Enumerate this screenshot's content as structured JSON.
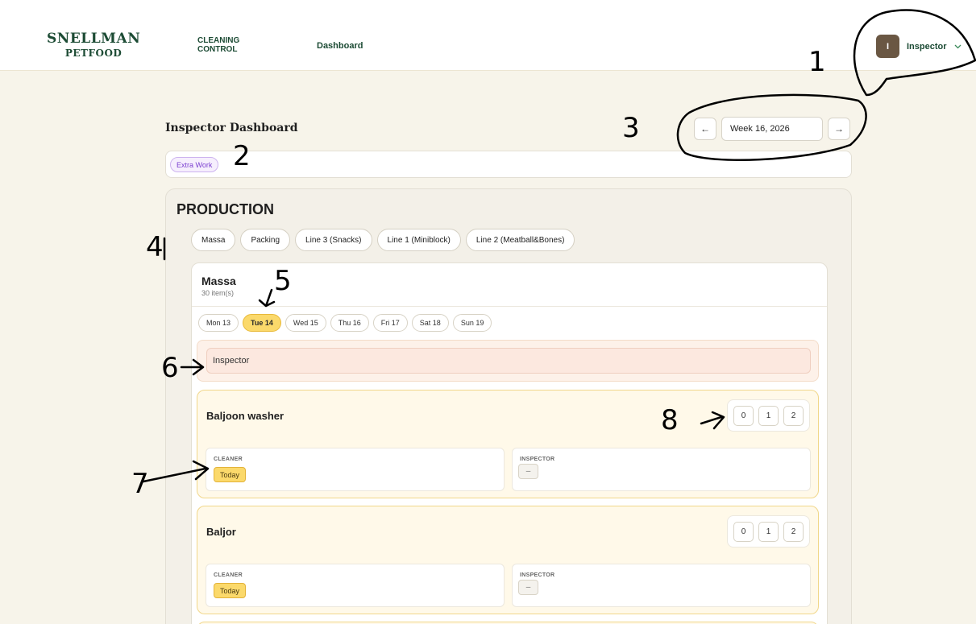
{
  "header": {
    "logo_line1": "SNELLMAN",
    "logo_line2": "PETFOOD",
    "app_line1": "CLEANING",
    "app_line2": "CONTROL",
    "nav_dashboard": "Dashboard",
    "user_initial": "I",
    "user_name": "Inspector"
  },
  "page": {
    "title": "Inspector Dashboard",
    "week_label": "Week 16, 2026",
    "prev_arrow": "←",
    "next_arrow": "→"
  },
  "filters": {
    "extra_work": "Extra Work"
  },
  "production": {
    "title": "PRODUCTION",
    "lines": [
      "Massa",
      "Packing",
      "Line 3 (Snacks)",
      "Line 1 (Miniblock)",
      "Line 2 (Meatball&Bones)"
    ],
    "area": {
      "name": "Massa",
      "count": "30 item(s)",
      "days": [
        "Mon 13",
        "Tue 14",
        "Wed 15",
        "Thu 16",
        "Fri 17",
        "Sat 18",
        "Sun 19"
      ],
      "active_day": "Tue 14",
      "inspector_field": "Inspector",
      "tasks": [
        {
          "name": "Baljoon washer",
          "scores": [
            "0",
            "1",
            "2"
          ],
          "cleaner_label": "CLEANER",
          "cleaner_status": "Today",
          "inspector_label": "INSPECTOR",
          "inspector_status": "–"
        },
        {
          "name": "Baljor",
          "scores": [
            "0",
            "1",
            "2"
          ],
          "cleaner_label": "CLEANER",
          "cleaner_status": "Today",
          "inspector_label": "INSPECTOR",
          "inspector_status": "–"
        }
      ]
    }
  },
  "annotations": [
    "1",
    "2",
    "3",
    "4",
    "5",
    "6",
    "7",
    "8"
  ],
  "colors": {
    "brand_green": "#1c4b34",
    "active_yellow": "#fbd96b",
    "extra_purple": "#7b3fd0",
    "page_bg": "#f7f4ea"
  }
}
